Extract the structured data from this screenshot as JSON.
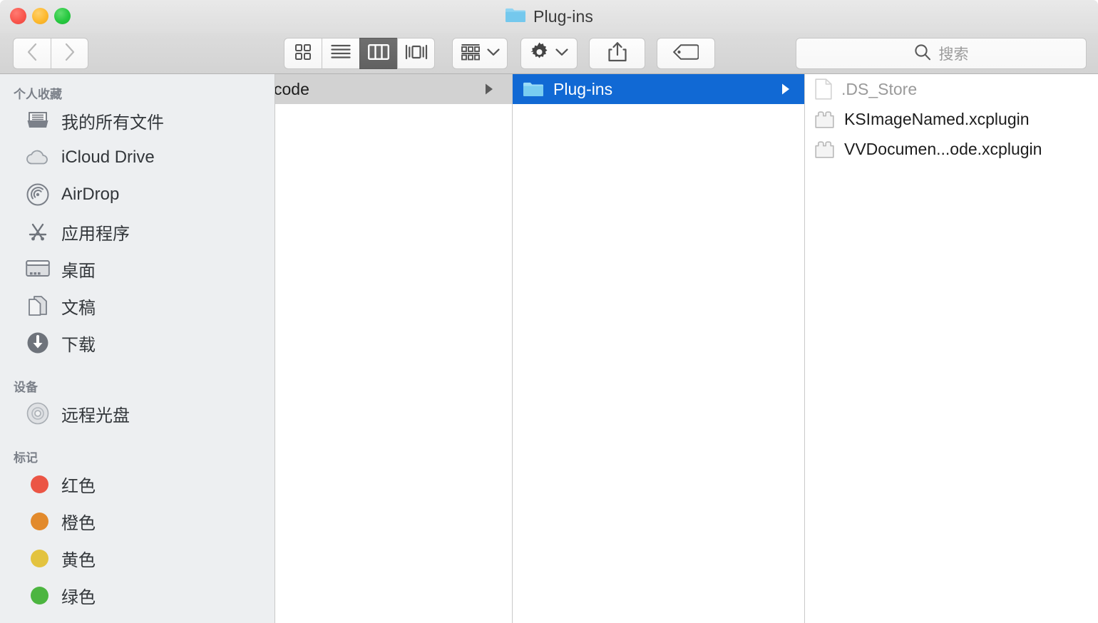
{
  "window": {
    "title": "Plug-ins",
    "title_icon": "folder-icon",
    "traffic_lights": [
      "close",
      "minimize",
      "maximize"
    ]
  },
  "toolbar": {
    "back_label": "back-chevron-icon",
    "forward_label": "forward-chevron-icon",
    "view_modes": [
      {
        "name": "icon-view",
        "icon": "grid-icon",
        "active": false
      },
      {
        "name": "list-view",
        "icon": "list-icon",
        "active": false
      },
      {
        "name": "column-view",
        "icon": "columns-icon",
        "active": true
      },
      {
        "name": "coverflow-view",
        "icon": "coverflow-icon",
        "active": false
      }
    ],
    "arrange": {
      "name": "arrange-button",
      "icon": "arrange-icon"
    },
    "action": {
      "name": "action-button",
      "icon": "gear-icon"
    },
    "share": {
      "name": "share-button",
      "icon": "share-icon"
    },
    "tag": {
      "name": "tag-button",
      "icon": "tag-icon"
    },
    "search": {
      "placeholder": "搜索",
      "value": "",
      "icon": "search-icon"
    }
  },
  "sidebar": {
    "sections": [
      {
        "title": "个人收藏",
        "items": [
          {
            "label": "我的所有文件",
            "icon": "all-my-files-icon"
          },
          {
            "label": "iCloud Drive",
            "icon": "icloud-icon"
          },
          {
            "label": "AirDrop",
            "icon": "airdrop-icon"
          },
          {
            "label": "应用程序",
            "icon": "applications-icon"
          },
          {
            "label": "桌面",
            "icon": "desktop-icon"
          },
          {
            "label": "文稿",
            "icon": "documents-icon"
          },
          {
            "label": "下载",
            "icon": "downloads-icon"
          }
        ]
      },
      {
        "title": "设备",
        "items": [
          {
            "label": "远程光盘",
            "icon": "remote-disc-icon"
          }
        ]
      },
      {
        "title": "标记",
        "items": [
          {
            "label": "红色",
            "icon": "tag-dot",
            "color": "#eb5545"
          },
          {
            "label": "橙色",
            "icon": "tag-dot",
            "color": "#e28a2c"
          },
          {
            "label": "黄色",
            "icon": "tag-dot",
            "color": "#e3c33f"
          },
          {
            "label": "绿色",
            "icon": "tag-dot",
            "color": "#4cb540"
          }
        ]
      }
    ]
  },
  "columns": [
    {
      "name": "column-1",
      "rows": [
        {
          "label": "code",
          "icon": "none",
          "selected": "inactive",
          "has_arrow": true,
          "dim": false
        }
      ]
    },
    {
      "name": "column-2",
      "rows": [
        {
          "label": "Plug-ins",
          "icon": "folder-icon",
          "selected": "active",
          "has_arrow": true,
          "dim": false
        }
      ]
    },
    {
      "name": "column-3",
      "rows": [
        {
          "label": ".DS_Store",
          "icon": "document-icon",
          "selected": "none",
          "has_arrow": false,
          "dim": true
        },
        {
          "label": "KSImageNamed.xcplugin",
          "icon": "plugin-icon",
          "selected": "none",
          "has_arrow": false,
          "dim": false
        },
        {
          "label": "VVDocumen...ode.xcplugin",
          "icon": "plugin-icon",
          "selected": "none",
          "has_arrow": false,
          "dim": false
        }
      ]
    }
  ],
  "colors": {
    "selection_active": "#1169d4",
    "selection_inactive": "#d2d2d2",
    "sidebar_bg": "#edeff1",
    "folder_blue": "#6dc6ef"
  }
}
